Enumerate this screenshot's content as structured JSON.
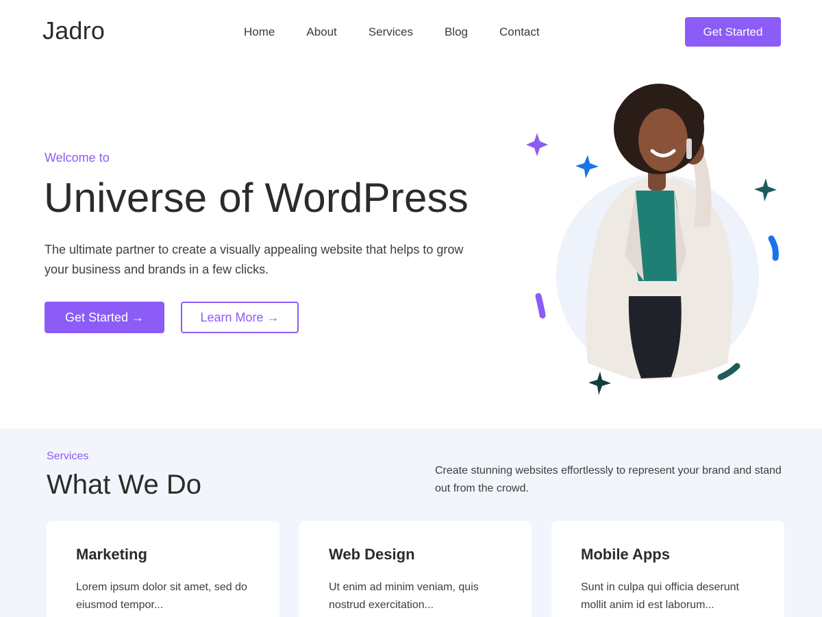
{
  "header": {
    "logo": "Jadro",
    "nav": [
      {
        "label": "Home"
      },
      {
        "label": "About"
      },
      {
        "label": "Services"
      },
      {
        "label": "Blog"
      },
      {
        "label": "Contact"
      }
    ],
    "cta_label": "Get Started"
  },
  "hero": {
    "eyebrow": "Welcome to",
    "title": "Universe of WordPress",
    "description": "The ultimate partner to create a visually appealing website that helps to grow your business and brands in a few clicks.",
    "primary_button": "Get Started →",
    "secondary_button": "Learn More →",
    "image_alt": "woman-on-phone-photo"
  },
  "services": {
    "eyebrow": "Services",
    "title": "What We Do",
    "description": "Create stunning websites effortlessly to represent your brand and stand out from the crowd.",
    "cards": [
      {
        "title": "Marketing",
        "text": "Lorem ipsum dolor sit amet, sed do eiusmod tempor..."
      },
      {
        "title": "Web Design",
        "text": "Ut enim ad minim veniam, quis nostrud exercitation..."
      },
      {
        "title": "Mobile Apps",
        "text": "Sunt in culpa qui officia deserunt mollit anim id est laborum..."
      }
    ]
  },
  "colors": {
    "accent": "#8b5cf6",
    "text": "#2b2b2b",
    "section_bg": "#f3f5fc",
    "star_blue": "#1a73e8",
    "star_teal": "#1e5c5c"
  }
}
